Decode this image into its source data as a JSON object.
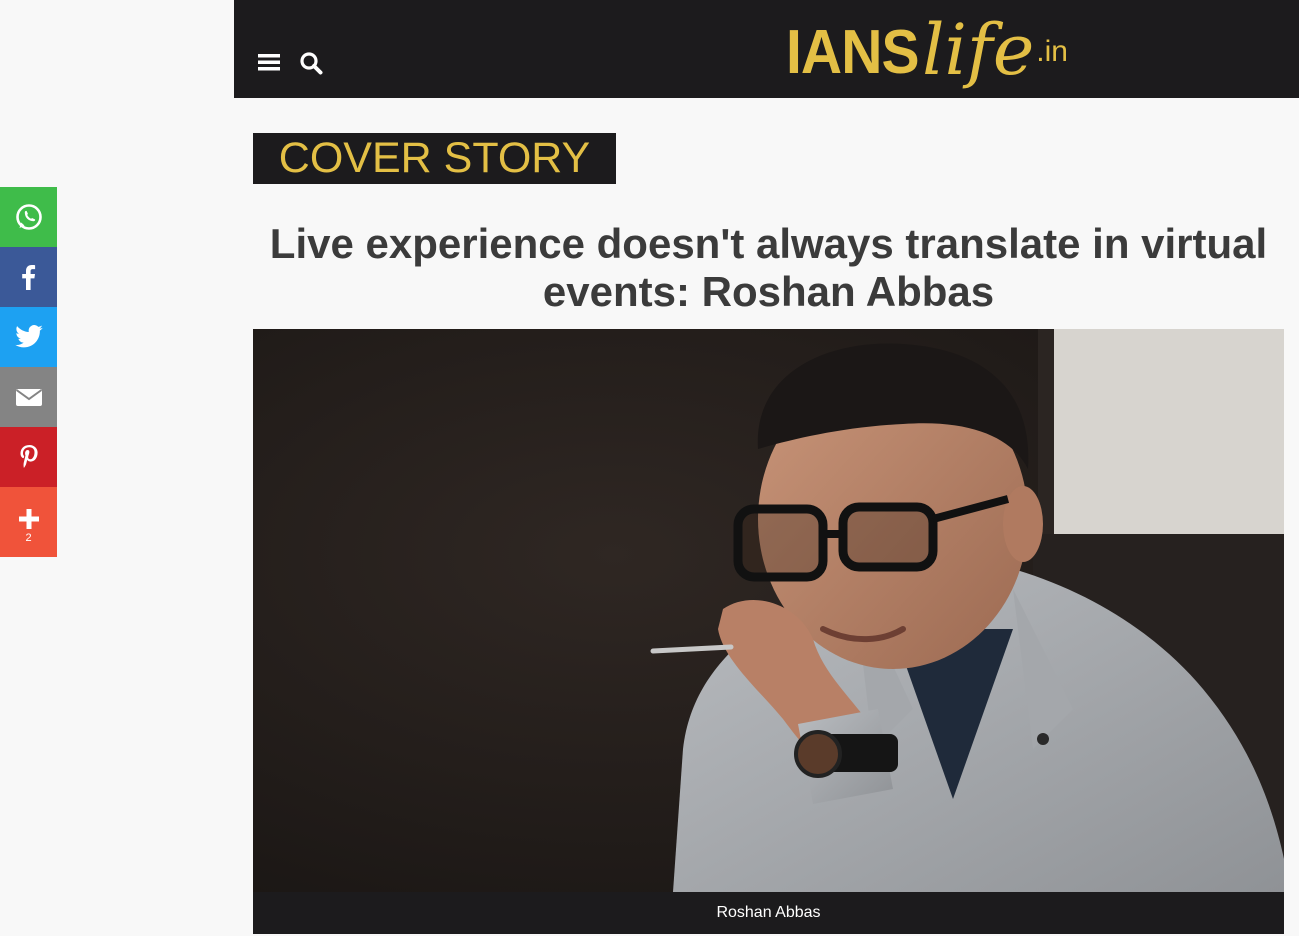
{
  "share_bar": {
    "buttons": [
      {
        "name": "whatsapp",
        "icon": "whatsapp-icon",
        "color": "#3fbc4a"
      },
      {
        "name": "facebook",
        "icon": "facebook-icon",
        "color": "#3b5998"
      },
      {
        "name": "twitter",
        "icon": "twitter-icon",
        "color": "#1da1f2"
      },
      {
        "name": "email",
        "icon": "email-icon",
        "color": "#848484"
      },
      {
        "name": "pinterest",
        "icon": "pinterest-icon",
        "color": "#cb2027"
      },
      {
        "name": "more",
        "icon": "plus-icon",
        "color": "#f0533a"
      }
    ],
    "more_count": "2"
  },
  "header": {
    "background": "#1c1b1d",
    "menu_icon": "hamburger-menu-icon",
    "search_icon": "search-icon",
    "logo": {
      "part1": "IANS",
      "part2": "life",
      "part3": ".in",
      "color": "#e3bf45"
    }
  },
  "article": {
    "category": "COVER STORY",
    "headline": "Live experience doesn't always translate in virtual events: Roshan Abbas",
    "image_caption": "Roshan Abbas"
  }
}
